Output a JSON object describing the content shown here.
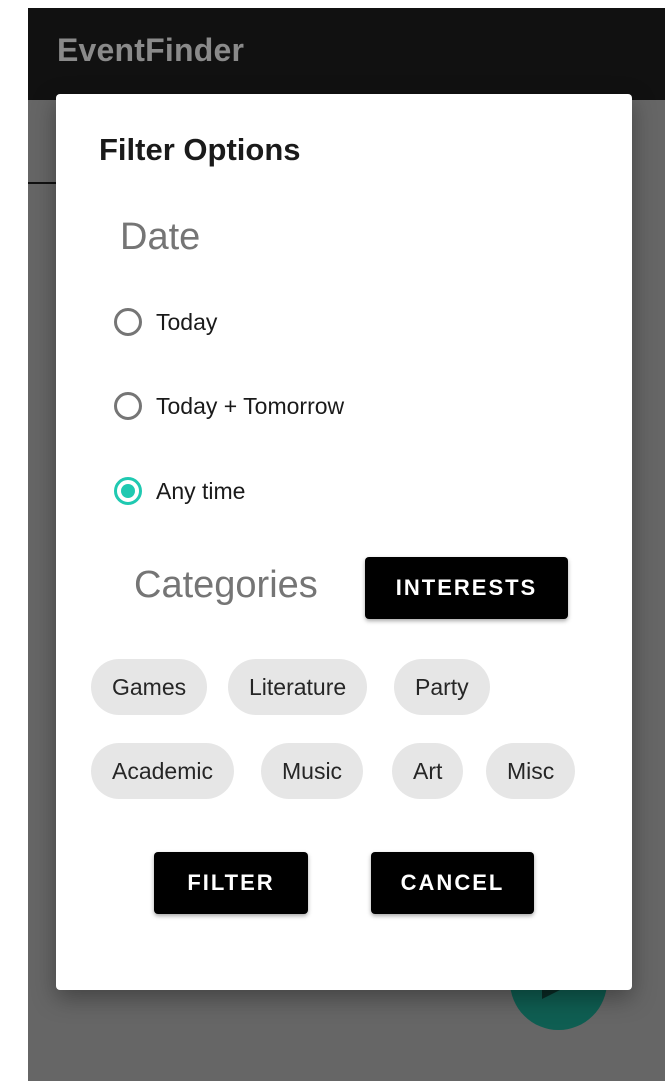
{
  "app": {
    "title": "EventFinder"
  },
  "dialog": {
    "title": "Filter Options",
    "date": {
      "heading": "Date",
      "options": [
        {
          "label": "Today",
          "selected": false
        },
        {
          "label": "Today + Tomorrow",
          "selected": false
        },
        {
          "label": "Any time",
          "selected": true
        }
      ]
    },
    "categories": {
      "heading": "Categories",
      "interests_button": "INTERESTS",
      "chips": [
        "Games",
        "Literature",
        "Party",
        "Academic",
        "Music",
        "Art",
        "Misc"
      ]
    },
    "actions": {
      "filter": "FILTER",
      "cancel": "CANCEL"
    }
  },
  "colors": {
    "accent": "#1fc9b1",
    "scrim": "#666666",
    "appbar": "#111111",
    "fab": "#0f5e52"
  },
  "icons": {
    "fab": "send-icon",
    "radio_selected": "radio-selected-icon",
    "radio_unselected": "radio-unselected-icon"
  }
}
